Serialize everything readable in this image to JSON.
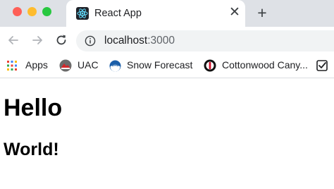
{
  "browser": {
    "tab": {
      "title": "React App",
      "favicon": "react-logo-icon"
    },
    "new_tab_icon": "plus-icon",
    "close_tab_icon": "close-icon",
    "nav": {
      "back_icon": "arrow-left-icon",
      "forward_icon": "arrow-right-icon",
      "reload_icon": "reload-icon"
    },
    "address": {
      "host": "localhost",
      "port": ":3000",
      "icon": "info-icon"
    },
    "bookmarks": [
      {
        "label": "Apps",
        "icon": "apps-grid-icon"
      },
      {
        "label": "UAC",
        "icon": "uac-logo-icon"
      },
      {
        "label": "Snow Forecast",
        "icon": "noaa-logo-icon"
      },
      {
        "label": "Cottonwood Cany...",
        "icon": "cottonwood-logo-icon"
      }
    ],
    "bookmark_overflow_icon": "checkbox-icon"
  },
  "page": {
    "heading": "Hello",
    "subheading": "World!"
  },
  "colors": {
    "tabstrip": "#dee1e6",
    "omnibox": "#f1f3f4",
    "close": "#fe5f57",
    "minimize": "#febc2e",
    "maximize": "#28c840"
  }
}
